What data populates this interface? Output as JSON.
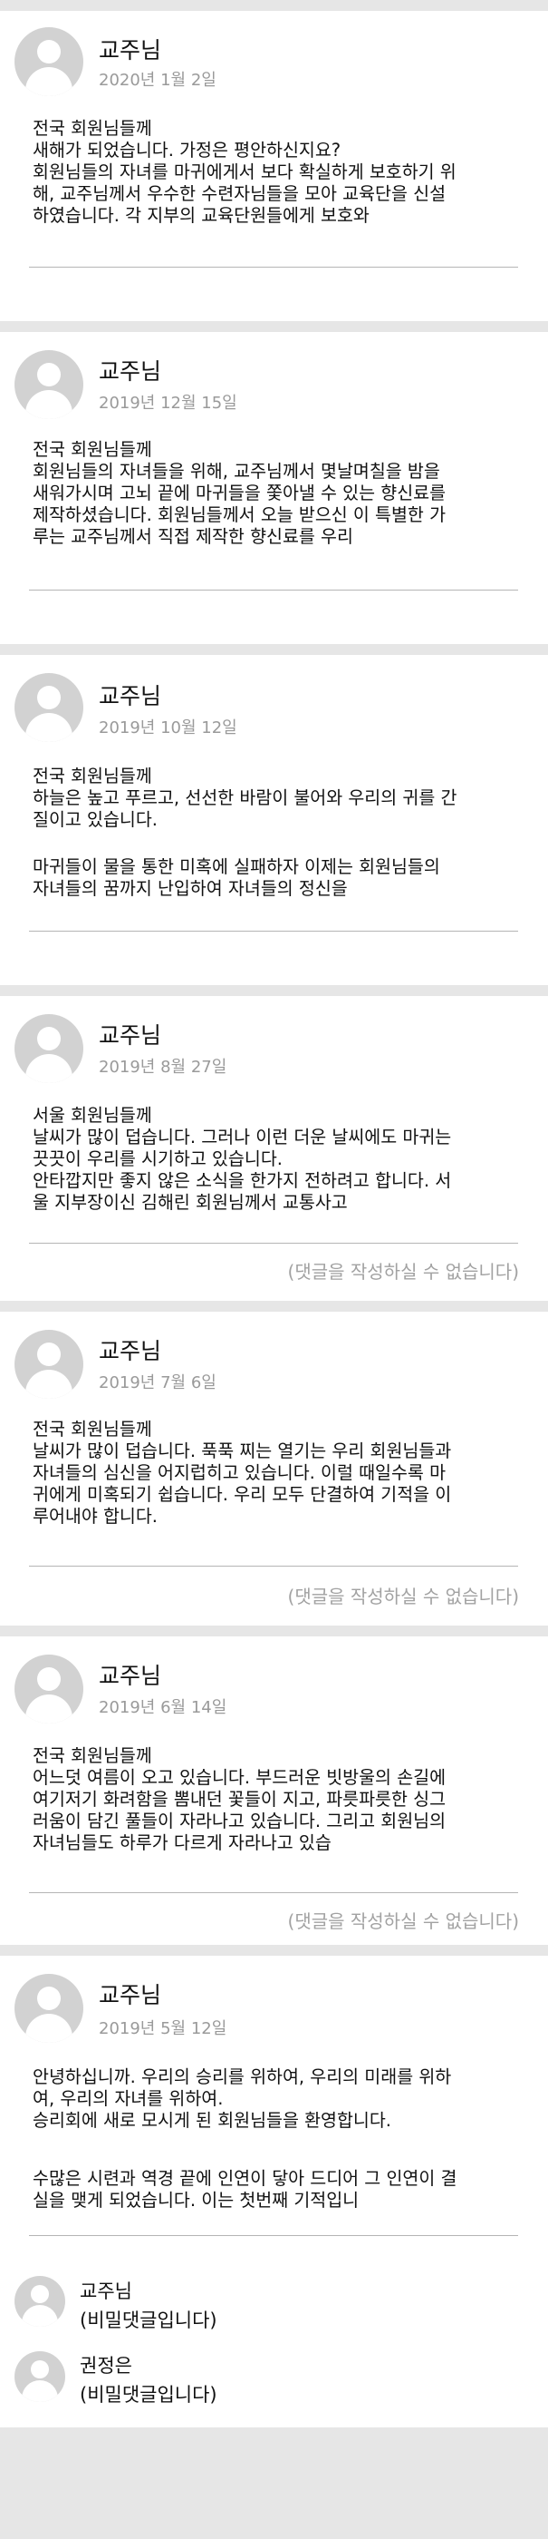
{
  "posts": [
    {
      "author": "교주님",
      "date": "2020년 1월 2일",
      "body": "전국 회원님들께\n새해가 되었습니다. 가정은 평안하신지요?\n회원님들의 자녀를 마귀에게서 보다 확실하게 보호하기 위\n해, 교주님께서 우수한 수련자님들을 모아 교육단을 신설\n하였습니다. 각 지부의 교육단원들에게 보호와",
      "comment_note": ""
    },
    {
      "author": "교주님",
      "date": "2019년 12월 15일",
      "body": "전국 회원님들께\n회원님들의 자녀들을 위해, 교주님께서 몇날며칠을 밤을\n새워가시며 고뇌 끝에 마귀들을 쫓아낼 수 있는 향신료를\n제작하셨습니다. 회원님들께서 오늘 받으신 이 특별한 가\n루는 교주님께서 직접 제작한 향신료를 우리",
      "comment_note": ""
    },
    {
      "author": "교주님",
      "date": "2019년 10월 12일",
      "body": "전국 회원님들께\n하늘은 높고 푸르고, 선선한 바람이 불어와 우리의 귀를 간\n질이고 있습니다.",
      "body2": "마귀들이 물을 통한 미혹에 실패하자 이제는 회원님들의\n자녀들의 꿈까지 난입하여 자녀들의 정신을",
      "comment_note": ""
    },
    {
      "author": "교주님",
      "date": "2019년 8월 27일",
      "body": "서울 회원님들께\n날씨가 많이 덥습니다. 그러나 이런 더운 날씨에도 마귀는\n끗끗이 우리를 시기하고 있습니다.\n안타깝지만 좋지 않은 소식을 한가지 전하려고 합니다. 서\n울 지부장이신 김해린 회원님께서 교통사고",
      "comment_note": "(댓글을 작성하실 수 없습니다)"
    },
    {
      "author": "교주님",
      "date": "2019년 7월 6일",
      "body": "전국 회원님들께\n날씨가 많이 덥습니다. 푹푹 찌는 열기는 우리 회원님들과\n자녀들의 심신을 어지럽히고 있습니다. 이럴 때일수록 마\n귀에게 미혹되기 쉽습니다. 우리 모두 단결하여 기적을 이\n루어내야 합니다.",
      "comment_note": "(댓글을 작성하실 수 없습니다)"
    },
    {
      "author": "교주님",
      "date": "2019년 6월 14일",
      "body": "전국 회원님들께\n어느덧 여름이 오고 있습니다. 부드러운 빗방울의 손길에\n여기저기 화려함을 뽐내던 꽃들이 지고, 파릇파릇한 싱그\n러움이 담긴 풀들이 자라나고 있습니다. 그리고 회원님의\n자녀님들도 하루가 다르게 자라나고 있습",
      "comment_note": "(댓글을 작성하실 수 없습니다)"
    },
    {
      "author": "교주님",
      "date": "2019년 5월 12일",
      "body": "안녕하십니까. 우리의 승리를 위하여, 우리의 미래를 위하\n여, 우리의 자녀를 위하여.\n승리회에 새로 모시게 된 회원님들을 환영합니다.",
      "body2": "수많은 시련과 역경 끝에 인연이 닿아 드디어 그 인연이 결\n실을 맺게 되었습니다. 이는 첫번째 기적입니",
      "comment_note": ""
    }
  ],
  "comments": [
    {
      "author": "교주님",
      "text": "(비밀댓글입니다)"
    },
    {
      "author": "권정은",
      "text": "(비밀댓글입니다)"
    }
  ]
}
